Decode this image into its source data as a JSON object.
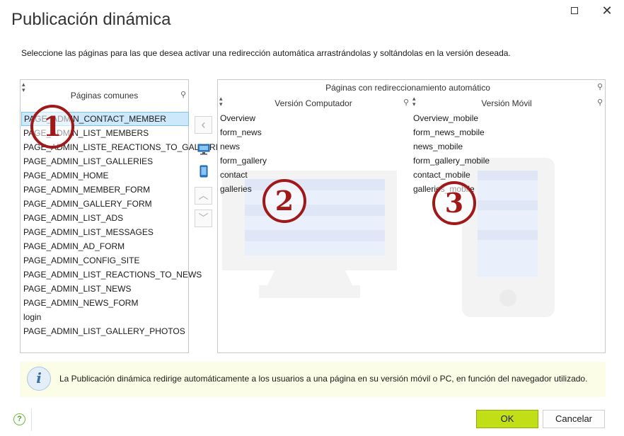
{
  "window": {
    "title": "Publicación dinámica",
    "maximize_icon": "maximize-icon",
    "close_glyph": "✕"
  },
  "instructions": "Seleccione las páginas para las que desea activar una redirección automática arrastrándolas y soltándolas en la versión deseada.",
  "common_pages": {
    "header": "Páginas comunes",
    "items": [
      "PAGE_ADMIN_CONTACT_MEMBER",
      "PAGE_ADMIN_LIST_MEMBERS",
      "PAGE_ADMIN_LISTE_REACTIONS_TO_GALLERIES",
      "PAGE_ADMIN_LIST_GALLERIES",
      "PAGE_ADMIN_HOME",
      "PAGE_ADMIN_MEMBER_FORM",
      "PAGE_ADMIN_GALLERY_FORM",
      "PAGE_ADMIN_LIST_ADS",
      "PAGE_ADMIN_LIST_MESSAGES",
      "PAGE_ADMIN_AD_FORM",
      "PAGE_ADMIN_CONFIG_SITE",
      "PAGE_ADMIN_LIST_REACTIONS_TO_NEWS",
      "PAGE_ADMIN_LIST_NEWS",
      "PAGE_ADMIN_NEWS_FORM",
      "login",
      "PAGE_ADMIN_LIST_GALLERY_PHOTOS"
    ],
    "selected_index": 0
  },
  "side_buttons": {
    "move_left": "‹",
    "assign_pc_icon": "monitor-icon",
    "assign_mobile_icon": "phone-icon",
    "move_up": "︿",
    "move_down": "﹀"
  },
  "redirect_pages": {
    "header": "Páginas con redireccionamiento automático",
    "pc_header": "Versión Computador",
    "mobile_header": "Versión Móvil",
    "pc_items": [
      "Overview",
      "form_news",
      "news",
      "form_gallery",
      "contact",
      "galleries"
    ],
    "mobile_items": [
      "Overview_mobile",
      "form_news_mobile",
      "news_mobile",
      "form_gallery_mobile",
      "contact_mobile",
      "galleries_mobile"
    ]
  },
  "callouts": [
    "1",
    "2",
    "3"
  ],
  "info": {
    "icon": "i",
    "text": "La Publicación dinámica redirige automáticamente a los usuarios a una página en su versión móvil o PC, en función del navegador utilizado."
  },
  "help_icon": "?",
  "buttons": {
    "ok": "OK",
    "cancel": "Cancelar"
  },
  "colors": {
    "accent_ok": "#c1df16",
    "callout": "#a01818",
    "selection": "#cde8fb",
    "info_background": "#fcfde6"
  }
}
